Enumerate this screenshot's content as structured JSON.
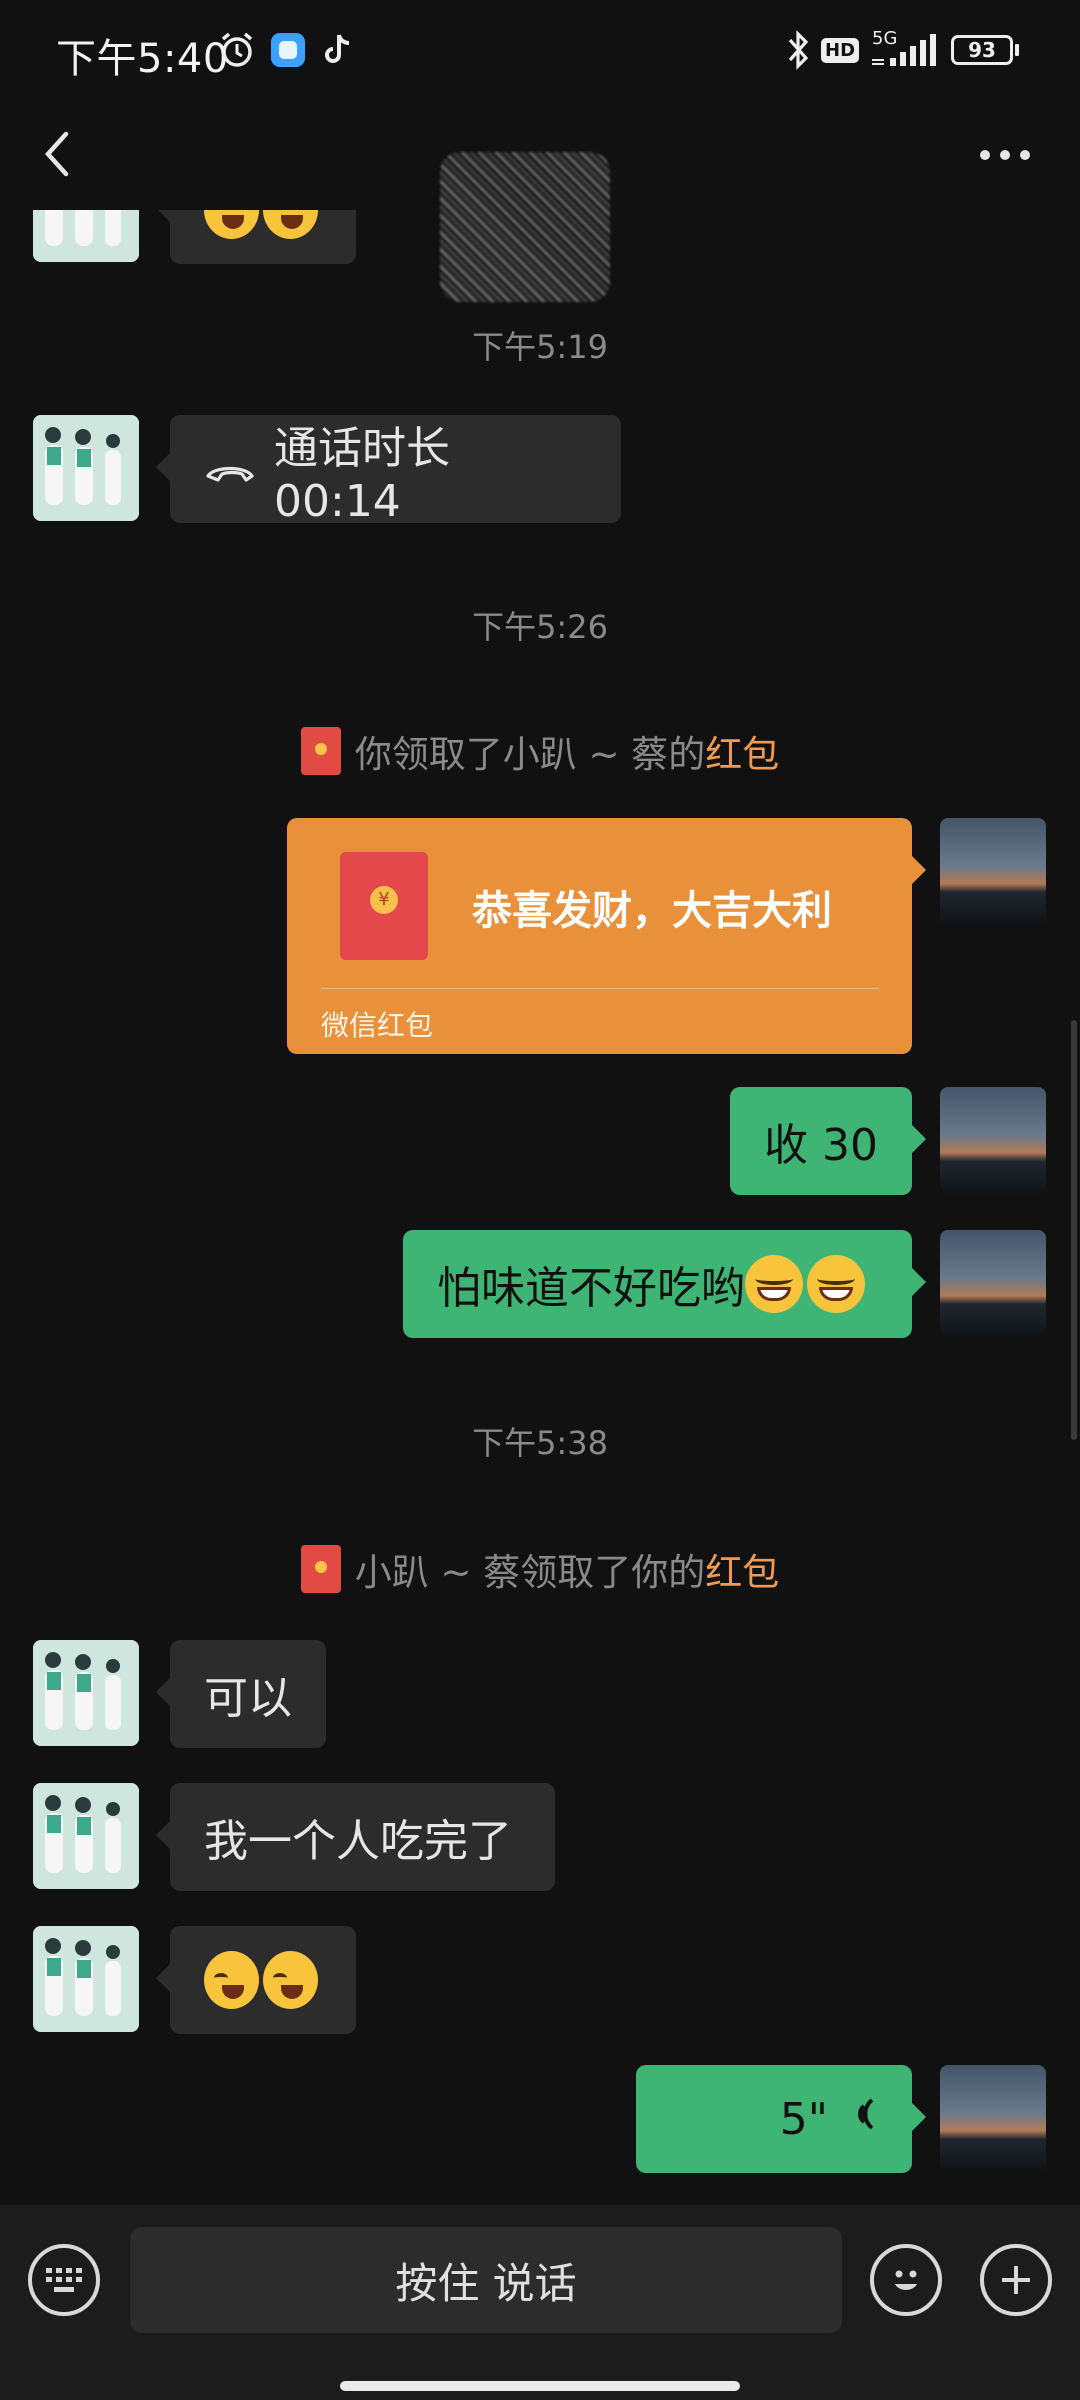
{
  "status_bar": {
    "time": "下午5:40",
    "network": "5G",
    "hd": "HD",
    "battery": "93"
  },
  "nav": {
    "title": ""
  },
  "messages": {
    "top_partial": {
      "emojis": [
        "crying-laughing",
        "crying-laughing"
      ]
    },
    "ts1": "下午5:19",
    "call": {
      "label": "通话时长 00:14"
    },
    "ts2": "下午5:26",
    "sys1": {
      "prefix": "你领取了小趴 ~ 蔡的",
      "highlight": "红包"
    },
    "red_packet": {
      "wish": "恭喜发财，大吉大利",
      "label": "微信红包"
    },
    "msg_received_30": "收 30",
    "msg_taste": "怕味道不好吃哟",
    "ts3": "下午5:38",
    "sys2": {
      "prefix": "小趴 ~ 蔡领取了你的",
      "highlight": "红包"
    },
    "msg_ok": "可以",
    "msg_ate": "我一个人吃完了",
    "voice": {
      "duration": "5\""
    }
  },
  "bottom_bar": {
    "voice_button": "按住 说话"
  },
  "colors": {
    "background": "#111111",
    "bubble_sent": "#3eb575",
    "bubble_received": "#2c2c2c",
    "red_packet": "#e8913a",
    "highlight": "#f39a52"
  }
}
